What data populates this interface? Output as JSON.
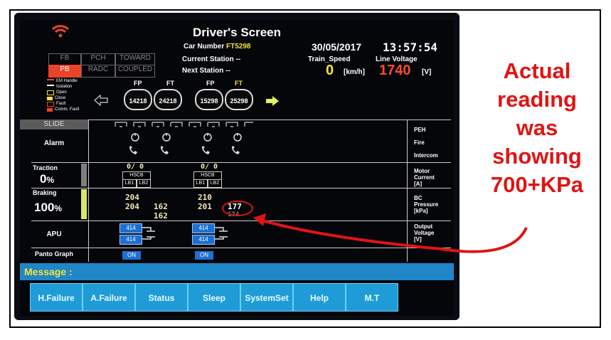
{
  "header": {
    "title": "Driver's Screen",
    "date": "30/05/2017",
    "time": "13:57:54",
    "car_number_label": "Car Number",
    "car_number": "FT5298",
    "current_station_label": "Current Station --",
    "next_station_label": "Next Station --",
    "train_speed_label": "Train_Speed",
    "train_speed_value": "0",
    "train_speed_unit": "[km/h]",
    "line_voltage_label": "Line Voltage",
    "line_voltage_value": "1740",
    "line_voltage_unit": "[V]"
  },
  "mode_tiles": {
    "row1": [
      "FB",
      "PCH",
      "TOWARD"
    ],
    "row2": [
      "PB",
      "RADC",
      "COUPLED"
    ]
  },
  "legend": {
    "items": [
      "EM Handle",
      "Isolation",
      "Open",
      "Close",
      "Fault",
      "Comm. Fault"
    ]
  },
  "cars": {
    "types": [
      "FP",
      "FT",
      "FP",
      "FT"
    ],
    "numbers": [
      "14218",
      "24218",
      "15298",
      "25298"
    ]
  },
  "rows": {
    "slide": "SLIDE",
    "alarm": "Alarm",
    "traction": "Traction",
    "traction_value": "0",
    "traction_unit": "%",
    "braking": "Braking",
    "braking_value": "100",
    "braking_unit": "%",
    "apu": "APU",
    "panto": "Panto Graph"
  },
  "right_labels": {
    "peh": "PEH",
    "fire": "Fire",
    "intercom": "Intercom",
    "motor_current": [
      "Motor",
      "Current",
      "[A]"
    ],
    "bc_pressure": [
      "BC",
      "Pressure",
      "[kPa]"
    ],
    "output_voltage": [
      "Output",
      "Voltage",
      "[V]"
    ]
  },
  "traction_data": {
    "car1": "0/ 0",
    "car3": "0/ 0",
    "hscb": "HSCB",
    "lb1": "LB1",
    "lb2": "LB2"
  },
  "bc_pressure": {
    "car1": [
      "204",
      "204"
    ],
    "car2": [
      "162",
      "162"
    ],
    "car3": [
      "210",
      "201"
    ],
    "car4": [
      "177",
      "174"
    ]
  },
  "apu_data": {
    "unit1": [
      "414",
      "414"
    ],
    "unit2": [
      "414",
      "414"
    ]
  },
  "panto_data": {
    "unit1": "ON",
    "unit2": "ON"
  },
  "message": {
    "label": "Message :"
  },
  "function_buttons": [
    "H.Failure",
    "A.Failure",
    "Status",
    "Sleep",
    "SystemSet",
    "Help",
    "M.T"
  ],
  "annotation": {
    "lines": [
      "Actual",
      "reading",
      "was",
      "showing",
      "700+KPa"
    ]
  },
  "colors": {
    "accent_yellow": "#f5e23a",
    "voltage_red": "#ff4a2a",
    "button_blue": "#1f9bd8",
    "annotation_red": "#e01414"
  }
}
